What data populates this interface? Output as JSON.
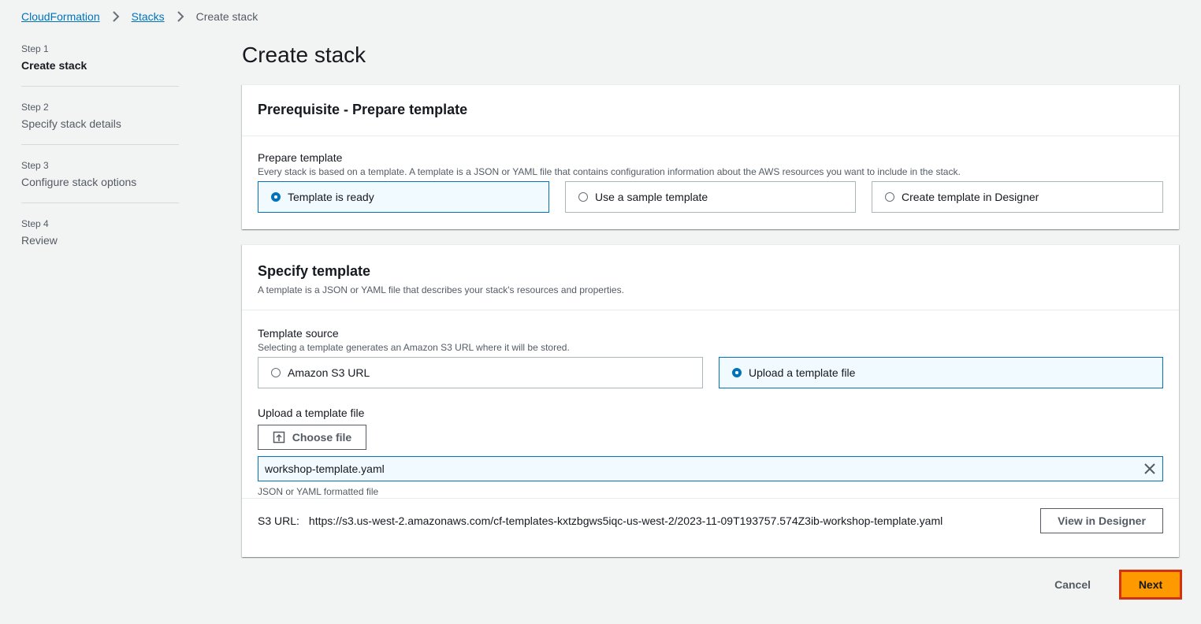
{
  "breadcrumb": {
    "items": [
      "CloudFormation",
      "Stacks"
    ],
    "current": "Create stack"
  },
  "steps": [
    {
      "num": "Step 1",
      "title": "Create stack"
    },
    {
      "num": "Step 2",
      "title": "Specify stack details"
    },
    {
      "num": "Step 3",
      "title": "Configure stack options"
    },
    {
      "num": "Step 4",
      "title": "Review"
    }
  ],
  "page_title": "Create stack",
  "prereq": {
    "heading": "Prerequisite - Prepare template",
    "label": "Prepare template",
    "description": "Every stack is based on a template. A template is a JSON or YAML file that contains configuration information about the AWS resources you want to include in the stack.",
    "options": [
      "Template is ready",
      "Use a sample template",
      "Create template in Designer"
    ],
    "selected": 0
  },
  "specify": {
    "heading": "Specify template",
    "description": "A template is a JSON or YAML file that describes your stack's resources and properties.",
    "source_label": "Template source",
    "source_description": "Selecting a template generates an Amazon S3 URL where it will be stored.",
    "source_options": [
      "Amazon S3 URL",
      "Upload a template file"
    ],
    "source_selected": 1,
    "upload_label": "Upload a template file",
    "choose_file": "Choose file",
    "file_name": "workshop-template.yaml",
    "file_hint": "JSON or YAML formatted file",
    "s3_label": "S3 URL:",
    "s3_url": "https://s3.us-west-2.amazonaws.com/cf-templates-kxtzbgws5iqc-us-west-2/2023-11-09T193757.574Z3ib-workshop-template.yaml",
    "view_designer": "View in Designer"
  },
  "actions": {
    "cancel": "Cancel",
    "next": "Next"
  },
  "colors": {
    "link": "#0073bb",
    "primary": "#ff9900",
    "highlight_border": "#d13212",
    "selected_tile_bg": "#f1faff"
  }
}
